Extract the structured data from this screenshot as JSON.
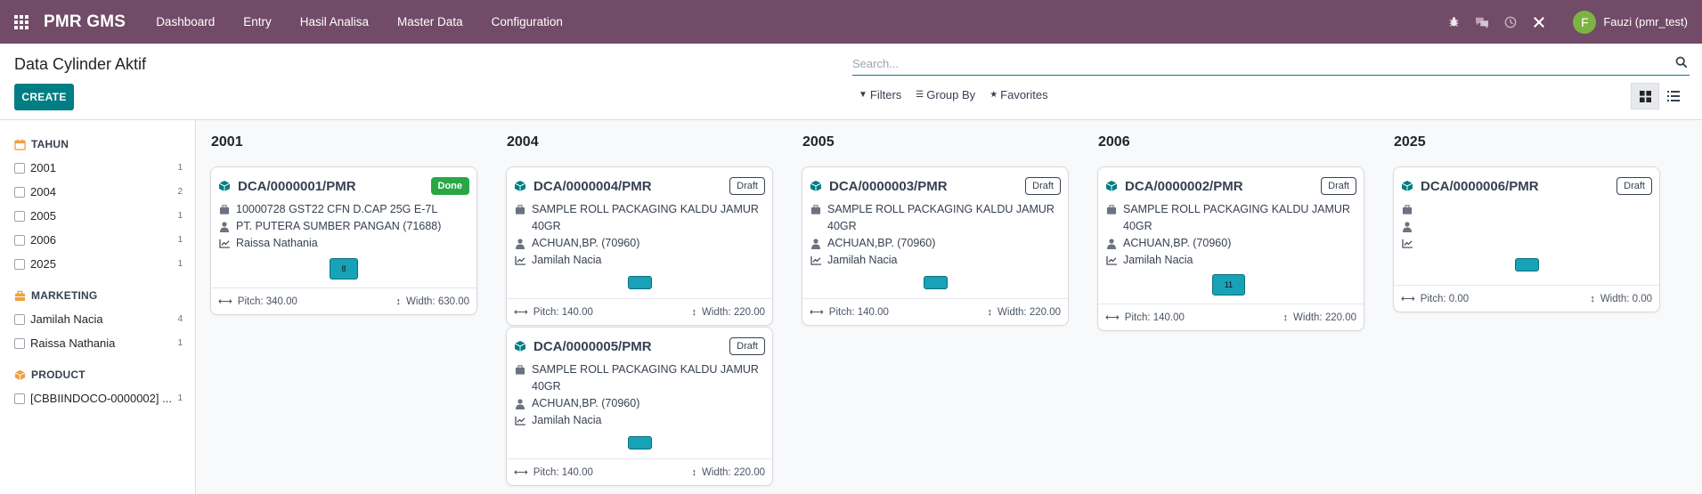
{
  "navbar": {
    "brand": "PMR GMS",
    "menu": [
      "Dashboard",
      "Entry",
      "Hasil Analisa",
      "Master Data",
      "Configuration"
    ],
    "user": {
      "initial": "F",
      "name": "Fauzi (pmr_test)"
    },
    "icons": [
      "bug-icon",
      "chat-icon",
      "clock-icon",
      "tools-icon"
    ]
  },
  "control": {
    "title": "Data Cylinder Aktif",
    "create_label": "CREATE",
    "search_placeholder": "Search...",
    "filters_label": "Filters",
    "groupby_label": "Group By",
    "favorites_label": "Favorites"
  },
  "sidebar": {
    "sections": [
      {
        "title": "TAHUN",
        "icon": "calendar-icon",
        "color": "#f0a041",
        "items": [
          {
            "label": "2001",
            "count": "1"
          },
          {
            "label": "2004",
            "count": "2"
          },
          {
            "label": "2005",
            "count": "1"
          },
          {
            "label": "2006",
            "count": "1"
          },
          {
            "label": "2025",
            "count": "1"
          }
        ]
      },
      {
        "title": "MARKETING",
        "icon": "briefcase-icon",
        "color": "#f0a041",
        "items": [
          {
            "label": "Jamilah Nacia",
            "count": "4"
          },
          {
            "label": "Raissa Nathania",
            "count": "1"
          }
        ]
      },
      {
        "title": "PRODUCT",
        "icon": "box-icon",
        "color": "#f0a041",
        "items": [
          {
            "label": "[CBBIINDOCO-0000002] ...",
            "count": "1"
          }
        ]
      }
    ]
  },
  "kanban": {
    "columns": [
      {
        "title": "2001",
        "cards": [
          {
            "ref": "DCA/0000001/PMR",
            "status": "Done",
            "product": "10000728 GST22 CFN D.CAP 25G E-7L",
            "customer": "PT. PUTERA SUMBER PANGAN (71688)",
            "marketing": "Raissa Nathania",
            "tag": "8",
            "pitch": "Pitch: 340.00",
            "width": "Width: 630.00"
          }
        ]
      },
      {
        "title": "2004",
        "cards": [
          {
            "ref": "DCA/0000004/PMR",
            "status": "Draft",
            "product": "SAMPLE ROLL PACKAGING KALDU JAMUR 40GR",
            "customer": "ACHUAN,BP. (70960)",
            "marketing": "Jamilah Nacia",
            "tag": "",
            "pitch": "Pitch: 140.00",
            "width": "Width: 220.00"
          },
          {
            "ref": "DCA/0000005/PMR",
            "status": "Draft",
            "product": "SAMPLE ROLL PACKAGING KALDU JAMUR 40GR",
            "customer": "ACHUAN,BP. (70960)",
            "marketing": "Jamilah Nacia",
            "tag": "",
            "pitch": "Pitch: 140.00",
            "width": "Width: 220.00"
          }
        ]
      },
      {
        "title": "2005",
        "cards": [
          {
            "ref": "DCA/0000003/PMR",
            "status": "Draft",
            "product": "SAMPLE ROLL PACKAGING KALDU JAMUR 40GR",
            "customer": "ACHUAN,BP. (70960)",
            "marketing": "Jamilah Nacia",
            "tag": "",
            "pitch": "Pitch: 140.00",
            "width": "Width: 220.00"
          }
        ]
      },
      {
        "title": "2006",
        "cards": [
          {
            "ref": "DCA/0000002/PMR",
            "status": "Draft",
            "product": "SAMPLE ROLL PACKAGING KALDU JAMUR 40GR",
            "customer": "ACHUAN,BP. (70960)",
            "marketing": "Jamilah Nacia",
            "tag": "11",
            "pitch": "Pitch: 140.00",
            "width": "Width: 220.00"
          }
        ]
      },
      {
        "title": "2025",
        "cards": [
          {
            "ref": "DCA/0000006/PMR",
            "status": "Draft",
            "product": "",
            "customer": "",
            "marketing": "",
            "tag": "",
            "pitch": "Pitch: 0.00",
            "width": "Width: 0.00"
          }
        ]
      }
    ]
  },
  "colors": {
    "navbar": "#714b67",
    "primary": "#017e84",
    "tag": "#17a2b8",
    "done": "#28a745"
  }
}
